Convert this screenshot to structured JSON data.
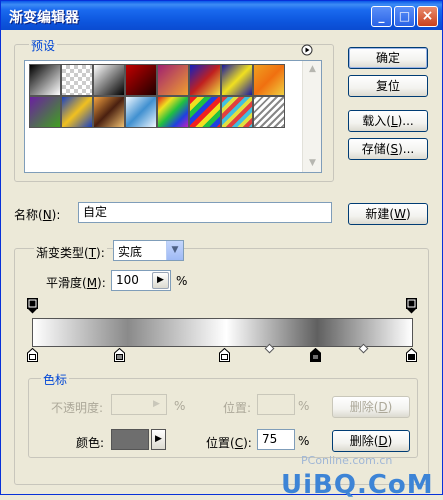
{
  "window": {
    "title": "渐变编辑器"
  },
  "presets": {
    "group_label": "预设",
    "swatches": [
      "linear-gradient(135deg,#000,#fff)",
      "repeating-conic-gradient(#ccc 0% 25%, #fff 0% 50%) 0 0/8px 8px",
      "linear-gradient(135deg,#fff,#000)",
      "linear-gradient(135deg,#c00000,#200000)",
      "linear-gradient(135deg,#a02070,#f0a030)",
      "linear-gradient(135deg,#1020c0,#c02020,#f0e040)",
      "linear-gradient(135deg,#1818a0,#f0e020,#1818a0)",
      "linear-gradient(135deg,#f0a020,#f07010,#f0d040)",
      "linear-gradient(135deg,#6a20a0,#40a020)",
      "linear-gradient(135deg,#1840c0,#f0c020,#1840c0)",
      "linear-gradient(135deg,#f0a040,#4a2010,#f0c070)",
      "linear-gradient(135deg,#f0f8ff,#4090d0,#f0f8ff)",
      "linear-gradient(135deg,#e02020,#f0e020,#20c040,#2040e0,#c020c0)",
      "repeating-linear-gradient(135deg,#f02020 0 5px,#f0e020 5px 10px,#20c040 10px 15px,#2040e0 15px 20px)",
      "repeating-linear-gradient(135deg,#e04040 0 4px,#40c0e0 4px 8px,#e0e040 8px 12px)",
      "repeating-linear-gradient(135deg,#888 0 2px,#fff 2px 5px)"
    ]
  },
  "buttons": {
    "ok": "确定",
    "reset": "复位",
    "load_prefix": "载入(",
    "load_key": "L",
    "load_suffix": ")...",
    "save_prefix": "存储(",
    "save_key": "S",
    "save_suffix": ")...",
    "new_prefix": "新建(",
    "new_key": "W",
    "new_suffix": ")"
  },
  "name_field": {
    "label_prefix": "名称(",
    "label_key": "N",
    "label_suffix": "):",
    "value": "自定"
  },
  "gradient_type": {
    "label_prefix": "渐变类型(",
    "label_key": "T",
    "label_suffix": "):",
    "value": "实底"
  },
  "smoothness": {
    "label_prefix": "平滑度(",
    "label_key": "M",
    "label_suffix": "):",
    "value": "100",
    "unit": "%"
  },
  "stops": {
    "group_label": "色标",
    "opacity_label": "不透明度:",
    "opacity_value": "",
    "opacity_unit": "%",
    "opacity_position_label": "位置:",
    "opacity_position_value": "",
    "opacity_position_unit": "%",
    "opacity_delete_prefix": "删除(",
    "opacity_delete_key": "D",
    "opacity_delete_suffix": ")",
    "color_label": "颜色:",
    "color_value": "#6e6e6e",
    "color_position_prefix": "位置(",
    "color_position_key": "C",
    "color_position_suffix": "):",
    "color_position_value": "75",
    "color_position_unit": "%",
    "color_delete_prefix": "删除(",
    "color_delete_key": "D",
    "color_delete_suffix": ")"
  },
  "watermark": {
    "main": "UiBQ.CoM",
    "sub": "PConline.com.cn"
  }
}
